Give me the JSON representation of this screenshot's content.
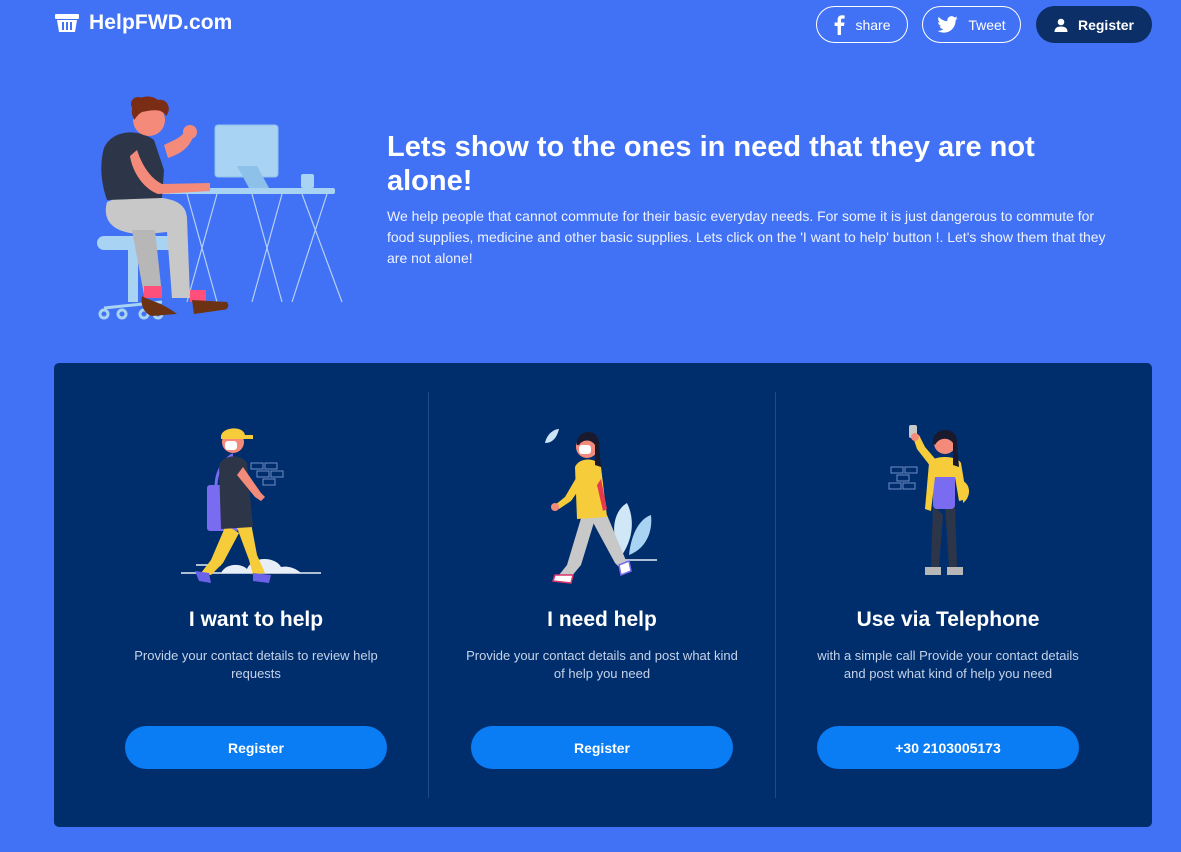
{
  "header": {
    "logo_text": "HelpFWD.com",
    "share_label": "share",
    "tweet_label": "Tweet",
    "register_label": "Register"
  },
  "hero": {
    "title": "Lets show to the ones in need that they are not alone!",
    "description": "We help people that cannot commute for their basic everyday needs. For some it is just dangerous to commute for food supplies, medicine and other basic supplies. Lets click on the 'I want to help' button !. Let's show them that they are not alone!"
  },
  "cards": [
    {
      "title": "I want to help",
      "description": "Provide your contact details to review help requests",
      "button_label": "Register"
    },
    {
      "title": "I need help",
      "description": "Provide your contact details and post what kind of help you need",
      "button_label": "Register"
    },
    {
      "title": "Use via Telephone",
      "description": "with a simple call Provide your contact details and post what kind of help you need",
      "button_label": "+30 2103005173"
    }
  ],
  "colors": {
    "background": "#4172f5",
    "panel": "#002e6d",
    "button": "#0a7cf4",
    "header_register": "#0b2f66"
  }
}
